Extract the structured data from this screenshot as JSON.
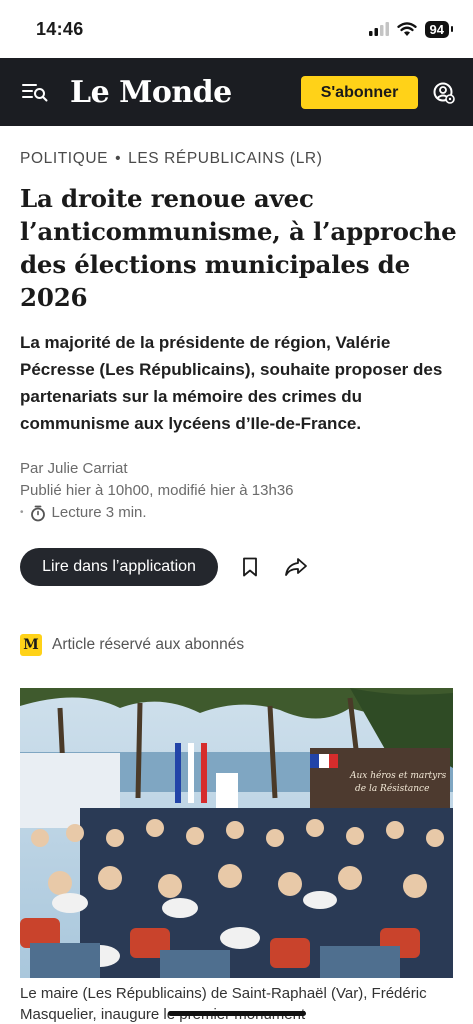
{
  "status_bar": {
    "time": "14:46",
    "battery": "94"
  },
  "header": {
    "logo": "Le Monde",
    "subscribe_label": "S'abonner"
  },
  "article": {
    "kicker_section": "Politique",
    "kicker_topic": "Les Républicains (LR)",
    "headline": "La droite renoue avec l’anticommunisme, à l’approche des élections municipales de 2026",
    "standfirst": "La majorité de la présidente de région, Valérie Pécresse (Les Républicains), souhaite proposer des partenariats sur la mémoire des crimes du communisme aux lycéens d’Ile-de-France.",
    "author": "Par Julie Carriat",
    "dates": "Publié hier à 10h00, modifié hier à 13h36",
    "reading_time": "Lecture 3 min.",
    "app_button_label": "Lire dans l’application",
    "premium_label": "Article réservé aux abonnés",
    "premium_badge": "M",
    "photo_banner_line1": "Aux héros et martyrs",
    "photo_banner_line2": "de la Résistance",
    "caption": "Le maire (Les Républicains) de Saint-Raphaël (Var), Frédéric Masquelier, inaugure le premier monument"
  },
  "colors": {
    "header_bg": "#1b1d22",
    "accent_yellow": "#ffd218",
    "button_dark": "#24272d"
  },
  "icons": [
    "signal-icon",
    "wifi-icon",
    "battery-icon",
    "menu-search-icon",
    "account-settings-icon",
    "clock-icon",
    "bookmark-icon",
    "share-icon"
  ]
}
